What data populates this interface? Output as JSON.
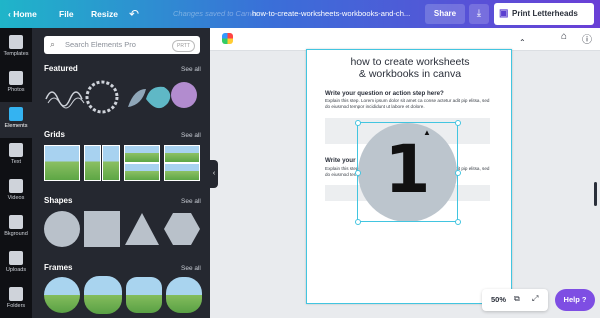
{
  "topbar": {
    "home_label": "Home",
    "file_label": "File",
    "resize_label": "Resize",
    "faded_text": "Changes saved to Canva",
    "doc_title": "how-to-create-worksheets-workbooks-and-ch...",
    "share_label": "Share",
    "print_label": "Print Letterheads"
  },
  "rail": {
    "items": [
      {
        "label": "Templates",
        "icon": "templates-icon"
      },
      {
        "label": "Photos",
        "icon": "photos-icon"
      },
      {
        "label": "Elements",
        "icon": "elements-icon"
      },
      {
        "label": "Text",
        "icon": "text-icon"
      },
      {
        "label": "Videos",
        "icon": "videos-icon"
      },
      {
        "label": "Bkground",
        "icon": "background-icon"
      },
      {
        "label": "Uploads",
        "icon": "uploads-icon"
      },
      {
        "label": "Folders",
        "icon": "folders-icon"
      }
    ]
  },
  "panel": {
    "search_placeholder": "Search Elements Pro",
    "search_badge": "PRTT",
    "sections": [
      {
        "title": "Featured",
        "see_all": "See all"
      },
      {
        "title": "Grids",
        "see_all": "See all"
      },
      {
        "title": "Shapes",
        "see_all": "See all"
      },
      {
        "title": "Frames",
        "see_all": "See all"
      }
    ]
  },
  "canvas": {
    "title_line1": "how to create worksheets",
    "title_line2": "& workbooks in canva",
    "q1_heading": "Write your question or action step here?",
    "q1_body": "Explain this step. Lorem ipsum dolor sit amet ca conse actetur adit pip elitsa, sed do eiusmod tempor incididunt ut labore et dolore.",
    "q2_heading": "Write your",
    "q2_body": "Explain this step. Lorem ipsum dolor sit amet ca conse actetur adit pip elitsa, sed do eiusmod tempor incididunt ut labore et dolore.",
    "big_number": "1"
  },
  "zoom": {
    "level": "50%"
  },
  "help_label": "Help ?",
  "colors": {
    "accent": "#7e4ee3",
    "selection": "#42c5e0",
    "panel_bg": "#252830"
  }
}
